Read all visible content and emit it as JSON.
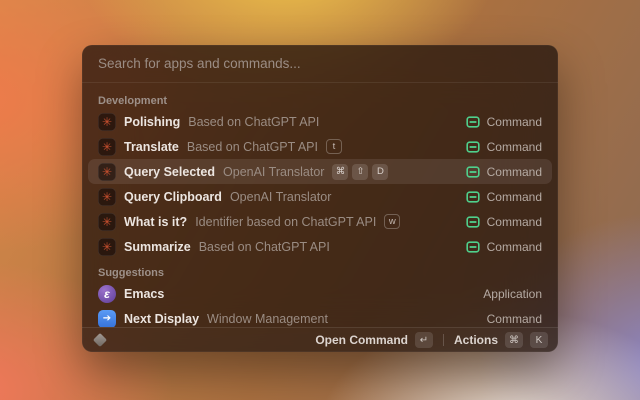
{
  "window": {
    "search_placeholder": "Search for apps and commands...",
    "sections": [
      {
        "title": "Development",
        "items": [
          {
            "title": "Polishing",
            "subtitle": "Based on ChatGPT API",
            "icon": "openai-translator",
            "alias": null,
            "shortcuts": [],
            "type": "Command",
            "type_icon": true,
            "selected": false
          },
          {
            "title": "Translate",
            "subtitle": "Based on ChatGPT API",
            "icon": "openai-translator",
            "alias": "t",
            "shortcuts": [],
            "type": "Command",
            "type_icon": true,
            "selected": false
          },
          {
            "title": "Query Selected",
            "subtitle": "OpenAI Translator",
            "icon": "openai-translator",
            "alias": null,
            "shortcuts": [
              "⌘",
              "⇧",
              "D"
            ],
            "type": "Command",
            "type_icon": true,
            "selected": true
          },
          {
            "title": "Query Clipboard",
            "subtitle": "OpenAI Translator",
            "icon": "openai-translator",
            "alias": null,
            "shortcuts": [],
            "type": "Command",
            "type_icon": true,
            "selected": false
          },
          {
            "title": "What is it?",
            "subtitle": "Identifier based on ChatGPT API",
            "icon": "openai-translator",
            "alias": "w",
            "shortcuts": [],
            "type": "Command",
            "type_icon": true,
            "selected": false
          },
          {
            "title": "Summarize",
            "subtitle": "Based on ChatGPT API",
            "icon": "openai-translator",
            "alias": null,
            "shortcuts": [],
            "type": "Command",
            "type_icon": true,
            "selected": false
          }
        ]
      },
      {
        "title": "Suggestions",
        "items": [
          {
            "title": "Emacs",
            "subtitle": null,
            "icon": "emacs",
            "alias": null,
            "shortcuts": [],
            "type": "Application",
            "type_icon": false,
            "selected": false
          },
          {
            "title": "Next Display",
            "subtitle": "Window Management",
            "icon": "next-display",
            "alias": null,
            "shortcuts": [],
            "type": "Command",
            "type_icon": false,
            "selected": false
          }
        ]
      }
    ],
    "footer": {
      "primary_action": "Open Command",
      "primary_key": "↵",
      "secondary_action": "Actions",
      "secondary_keys": [
        "⌘",
        "K"
      ]
    }
  },
  "icon_glyphs": {
    "openai-translator": "✳",
    "emacs": "ε",
    "next-display": "➔"
  },
  "colors": {
    "command-green": "#4fd08c",
    "selection": "rgba(255,255,255,0.09)",
    "window-tint": "rgba(30,17,12,0.74)",
    "bg-orange": "#ef7a4b",
    "bg-yellow": "#edc24a",
    "bg-coral": "#f4765c",
    "bg-cream": "#ece4dd",
    "bg-purple": "#8d86c8"
  }
}
